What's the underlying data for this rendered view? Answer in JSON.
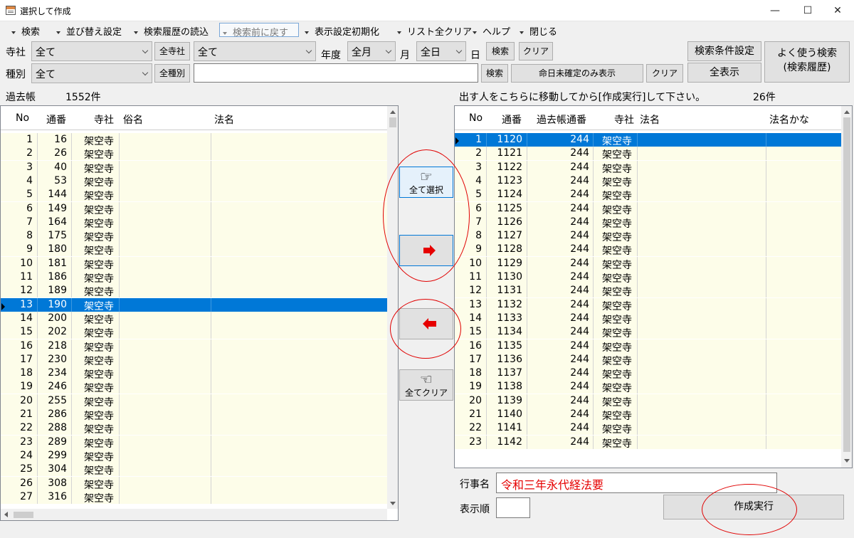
{
  "window": {
    "title": "選択して作成",
    "minimize": "—",
    "maximize": "☐",
    "close": "✕"
  },
  "menu": {
    "search": "検索",
    "sort": "並び替え設定",
    "load_history": "検索履歴の読込",
    "back": "検索前に戻す",
    "reset_display": "表示設定初期化",
    "clear_list": "リスト全クリア",
    "help": "ヘルプ",
    "close": "閉じる"
  },
  "filters": {
    "temple_label": "寺社",
    "temple_value": "全て",
    "all_temple_btn": "全寺社",
    "temple2_value": "全て",
    "year_label": "年度",
    "month_value": "全月",
    "month_label": "月",
    "day_value": "全日",
    "day_label": "日",
    "search_btn": "検索",
    "clear_btn": "クリア",
    "condition_btn": "検索条件設定",
    "favorite_btn": "よく使う検索\n(検索履歴)",
    "type_label": "種別",
    "type_value": "全て",
    "all_type_btn": "全種別",
    "text_value": "",
    "search2_btn": "検索",
    "undetermined_btn": "命日未確定のみ表示",
    "clear2_btn": "クリア",
    "show_all_btn": "全表示"
  },
  "left": {
    "label": "過去帳",
    "count": "1552件",
    "headers": {
      "no": "No",
      "tsuban": "通番",
      "temple": "寺社",
      "zokumyo": "俗名",
      "homyo": "法名"
    },
    "rows": [
      {
        "no": "1",
        "tsuban": "16",
        "temple": "架空寺"
      },
      {
        "no": "2",
        "tsuban": "26",
        "temple": "架空寺"
      },
      {
        "no": "3",
        "tsuban": "40",
        "temple": "架空寺"
      },
      {
        "no": "4",
        "tsuban": "53",
        "temple": "架空寺"
      },
      {
        "no": "5",
        "tsuban": "144",
        "temple": "架空寺"
      },
      {
        "no": "6",
        "tsuban": "149",
        "temple": "架空寺"
      },
      {
        "no": "7",
        "tsuban": "164",
        "temple": "架空寺"
      },
      {
        "no": "8",
        "tsuban": "175",
        "temple": "架空寺"
      },
      {
        "no": "9",
        "tsuban": "180",
        "temple": "架空寺"
      },
      {
        "no": "10",
        "tsuban": "181",
        "temple": "架空寺"
      },
      {
        "no": "11",
        "tsuban": "186",
        "temple": "架空寺"
      },
      {
        "no": "12",
        "tsuban": "189",
        "temple": "架空寺"
      },
      {
        "no": "13",
        "tsuban": "190",
        "temple": "架空寺",
        "selected": true
      },
      {
        "no": "14",
        "tsuban": "200",
        "temple": "架空寺"
      },
      {
        "no": "15",
        "tsuban": "202",
        "temple": "架空寺"
      },
      {
        "no": "16",
        "tsuban": "218",
        "temple": "架空寺"
      },
      {
        "no": "17",
        "tsuban": "230",
        "temple": "架空寺"
      },
      {
        "no": "18",
        "tsuban": "234",
        "temple": "架空寺"
      },
      {
        "no": "19",
        "tsuban": "246",
        "temple": "架空寺"
      },
      {
        "no": "20",
        "tsuban": "255",
        "temple": "架空寺"
      },
      {
        "no": "21",
        "tsuban": "286",
        "temple": "架空寺"
      },
      {
        "no": "22",
        "tsuban": "288",
        "temple": "架空寺"
      },
      {
        "no": "23",
        "tsuban": "289",
        "temple": "架空寺"
      },
      {
        "no": "24",
        "tsuban": "299",
        "temple": "架空寺"
      },
      {
        "no": "25",
        "tsuban": "304",
        "temple": "架空寺"
      },
      {
        "no": "26",
        "tsuban": "308",
        "temple": "架空寺"
      },
      {
        "no": "27",
        "tsuban": "316",
        "temple": "架空寺"
      }
    ]
  },
  "middle": {
    "select_all": "全て選択",
    "clear_all": "全てクリア"
  },
  "right": {
    "instruction": "出す人をこちらに移動してから[作成実行]して下さい。",
    "count": "26件",
    "headers": {
      "no": "No",
      "tsuban": "通番",
      "kakocho": "過去帳通番",
      "temple": "寺社",
      "homyo": "法名",
      "homyo_kana": "法名かな"
    },
    "rows": [
      {
        "no": "1",
        "tsuban": "1120",
        "kakocho": "244",
        "temple": "架空寺",
        "selected": true
      },
      {
        "no": "2",
        "tsuban": "1121",
        "kakocho": "244",
        "temple": "架空寺"
      },
      {
        "no": "3",
        "tsuban": "1122",
        "kakocho": "244",
        "temple": "架空寺"
      },
      {
        "no": "4",
        "tsuban": "1123",
        "kakocho": "244",
        "temple": "架空寺"
      },
      {
        "no": "5",
        "tsuban": "1124",
        "kakocho": "244",
        "temple": "架空寺"
      },
      {
        "no": "6",
        "tsuban": "1125",
        "kakocho": "244",
        "temple": "架空寺"
      },
      {
        "no": "7",
        "tsuban": "1126",
        "kakocho": "244",
        "temple": "架空寺"
      },
      {
        "no": "8",
        "tsuban": "1127",
        "kakocho": "244",
        "temple": "架空寺"
      },
      {
        "no": "9",
        "tsuban": "1128",
        "kakocho": "244",
        "temple": "架空寺"
      },
      {
        "no": "10",
        "tsuban": "1129",
        "kakocho": "244",
        "temple": "架空寺"
      },
      {
        "no": "11",
        "tsuban": "1130",
        "kakocho": "244",
        "temple": "架空寺"
      },
      {
        "no": "12",
        "tsuban": "1131",
        "kakocho": "244",
        "temple": "架空寺"
      },
      {
        "no": "13",
        "tsuban": "1132",
        "kakocho": "244",
        "temple": "架空寺"
      },
      {
        "no": "14",
        "tsuban": "1133",
        "kakocho": "244",
        "temple": "架空寺"
      },
      {
        "no": "15",
        "tsuban": "1134",
        "kakocho": "244",
        "temple": "架空寺"
      },
      {
        "no": "16",
        "tsuban": "1135",
        "kakocho": "244",
        "temple": "架空寺"
      },
      {
        "no": "17",
        "tsuban": "1136",
        "kakocho": "244",
        "temple": "架空寺"
      },
      {
        "no": "18",
        "tsuban": "1137",
        "kakocho": "244",
        "temple": "架空寺"
      },
      {
        "no": "19",
        "tsuban": "1138",
        "kakocho": "244",
        "temple": "架空寺"
      },
      {
        "no": "20",
        "tsuban": "1139",
        "kakocho": "244",
        "temple": "架空寺"
      },
      {
        "no": "21",
        "tsuban": "1140",
        "kakocho": "244",
        "temple": "架空寺"
      },
      {
        "no": "22",
        "tsuban": "1141",
        "kakocho": "244",
        "temple": "架空寺"
      },
      {
        "no": "23",
        "tsuban": "1142",
        "kakocho": "244",
        "temple": "架空寺"
      }
    ]
  },
  "bottom": {
    "event_label": "行事名",
    "event_value": "令和三年永代経法要",
    "order_label": "表示順",
    "order_value": "",
    "execute_btn": "作成実行"
  },
  "colors": {
    "selection": "#0078d7",
    "row_bg": "#fdfde9",
    "event_text": "#e60000",
    "annotation": "#e00000"
  }
}
